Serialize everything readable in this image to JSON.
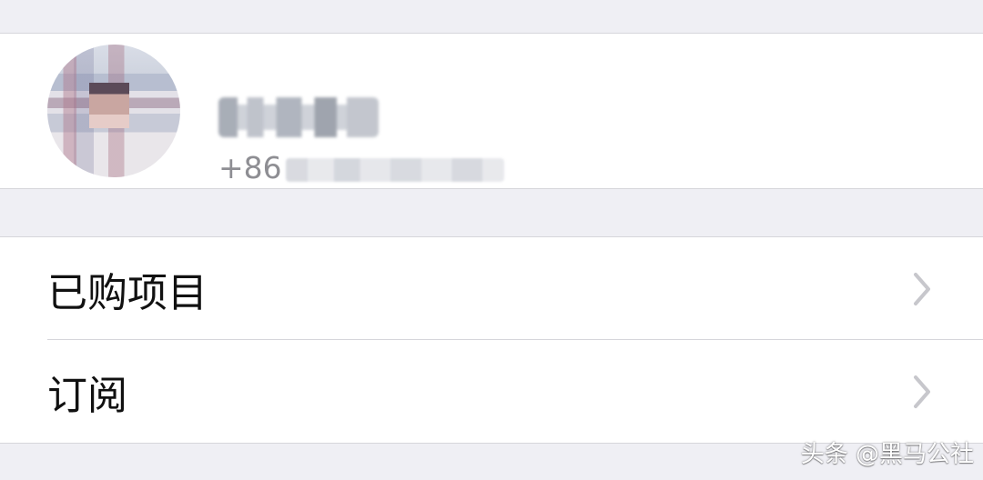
{
  "profile": {
    "phone_prefix": "+86",
    "name": "",
    "phone_number": ""
  },
  "menu": {
    "items": [
      {
        "label": "已购项目",
        "icon": "chevron-right-icon"
      },
      {
        "label": "订阅",
        "icon": "chevron-right-icon"
      }
    ]
  },
  "watermark": {
    "text": "头条 @黑马公社"
  },
  "colors": {
    "background": "#efeff4",
    "cell": "#ffffff",
    "separator": "#d6d6db",
    "secondary_text": "#8e8e93",
    "primary_text": "#111111"
  }
}
